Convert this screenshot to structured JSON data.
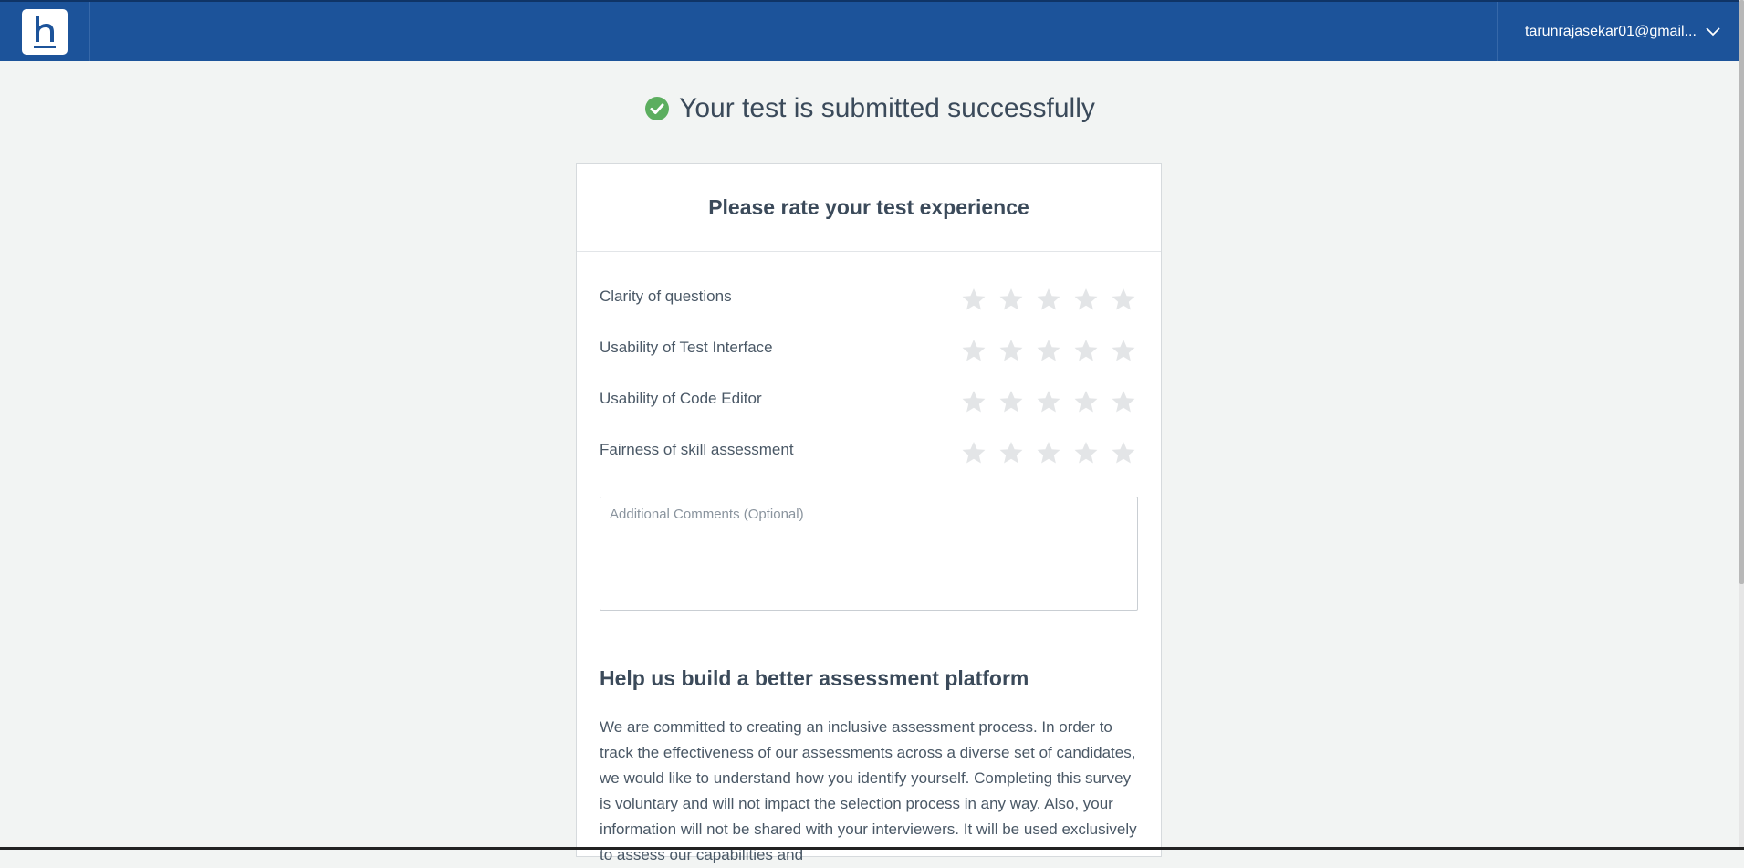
{
  "header": {
    "user_email": "tarunrajasekar01@gmail...",
    "brand_color": "#1c539a"
  },
  "status": {
    "message": "Your test is submitted successfully",
    "icon": "check-circle-icon",
    "icon_color": "#5cae5f"
  },
  "feedback": {
    "title": "Please rate your test experience",
    "ratings": [
      {
        "label": "Clarity of questions",
        "max_stars": 5,
        "value": 0
      },
      {
        "label": "Usability of Test Interface",
        "max_stars": 5,
        "value": 0
      },
      {
        "label": "Usability of Code Editor",
        "max_stars": 5,
        "value": 0
      },
      {
        "label": "Fairness of skill assessment",
        "max_stars": 5,
        "value": 0
      }
    ],
    "comments_placeholder": "Additional Comments (Optional)",
    "comments_value": ""
  },
  "survey": {
    "title": "Help us build a better assessment platform",
    "text": "We are committed to creating an inclusive assessment process. In order to track the effectiveness of our assessments across a diverse set of candidates, we would like to understand how you identify yourself. Completing this survey is voluntary and will not impact the selection process in any way. Also, your information will not be shared with your interviewers. It will be used exclusively to assess our capabilities and"
  }
}
